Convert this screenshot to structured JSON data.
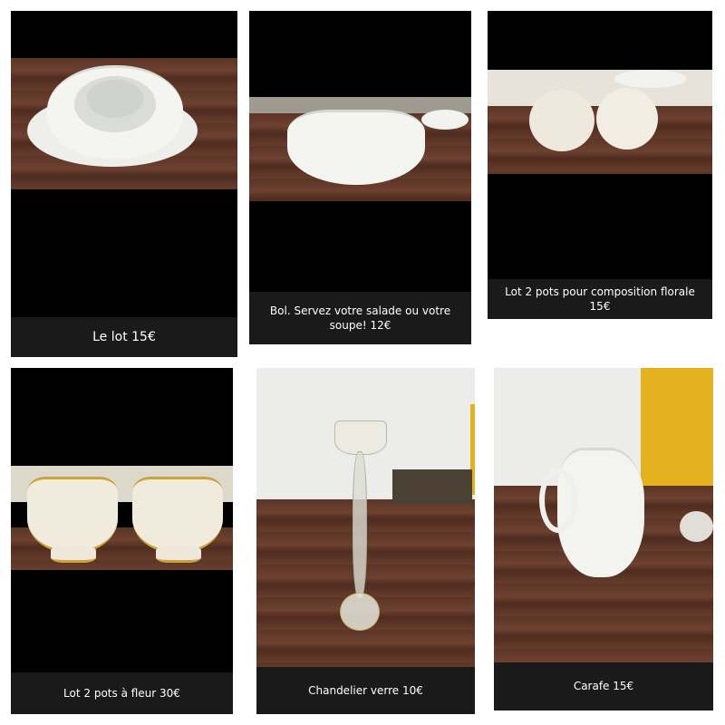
{
  "collage": {
    "background": "#ffffff",
    "tiles": [
      {
        "caption": "Le lot 15€",
        "subject": "stacked-plates-and-bowls"
      },
      {
        "caption": "Bol. Servez votre salade ou votre soupe! 12€",
        "subject": "white-salad-bowl"
      },
      {
        "caption": "Lot 2 pots pour composition florale 15€",
        "subject": "two-round-pots"
      },
      {
        "caption": "Lot 2 pots à fleur 30€",
        "subject": "two-gold-trim-flower-pots"
      },
      {
        "caption": "Chandelier verre 10€",
        "subject": "glass-candlestick"
      },
      {
        "caption": "Carafe 15€",
        "subject": "white-carafe"
      }
    ]
  },
  "colors": {
    "wood": "#5b3527",
    "porcelain": "#f2f2ee",
    "gold": "#c9a23a",
    "curtain": "#e3b21e",
    "caption_bg": "#1a1a1a",
    "caption_text": "#ffffff"
  }
}
